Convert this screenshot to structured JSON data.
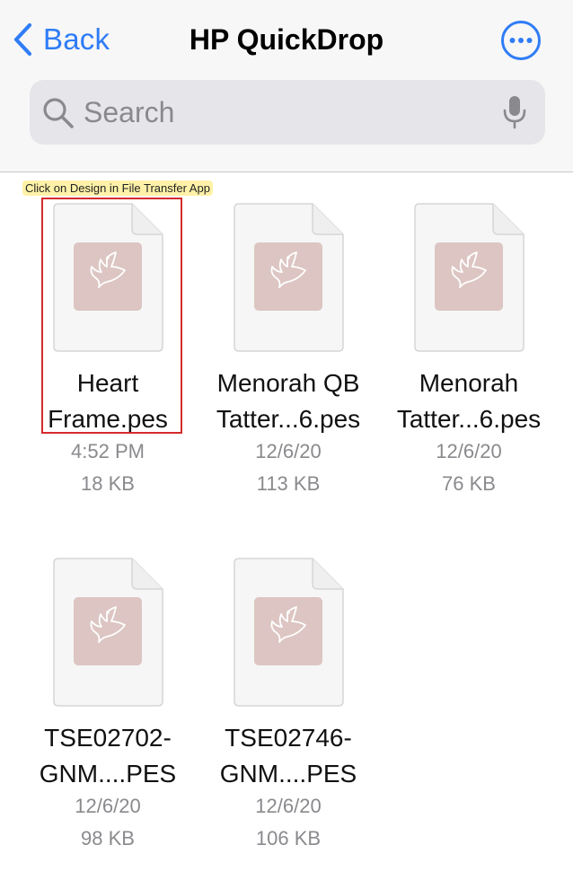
{
  "nav": {
    "back_label": "Back",
    "title": "HP QuickDrop",
    "more_icon": "ellipsis-circle-icon"
  },
  "search": {
    "placeholder": "Search",
    "value": ""
  },
  "annotation": {
    "text": "Click on Design in File Transfer App"
  },
  "colors": {
    "accent": "#2f7cf6",
    "header_bg": "#f7f7f7",
    "search_bg": "#e6e6ea",
    "thumb_bg": "#dcc5c2",
    "highlight": "#d42b2b",
    "annotation_bg": "#fff2a8"
  },
  "files": [
    {
      "name_line1": "Heart",
      "name_line2": "Frame.pes",
      "date": "4:52 PM",
      "size": "18 KB",
      "icon": "bird-icon"
    },
    {
      "name_line1": "Menorah QB",
      "name_line2": "Tatter...6.pes",
      "date": "12/6/20",
      "size": "113 KB",
      "icon": "bird-icon"
    },
    {
      "name_line1": "Menorah",
      "name_line2": "Tatter...6.pes",
      "date": "12/6/20",
      "size": "76 KB",
      "icon": "bird-icon"
    },
    {
      "name_line1": "TSE02702-",
      "name_line2": "GNM....PES",
      "date": "12/6/20",
      "size": "98 KB",
      "icon": "bird-icon"
    },
    {
      "name_line1": "TSE02746-",
      "name_line2": "GNM....PES",
      "date": "12/6/20",
      "size": "106 KB",
      "icon": "bird-icon"
    }
  ]
}
